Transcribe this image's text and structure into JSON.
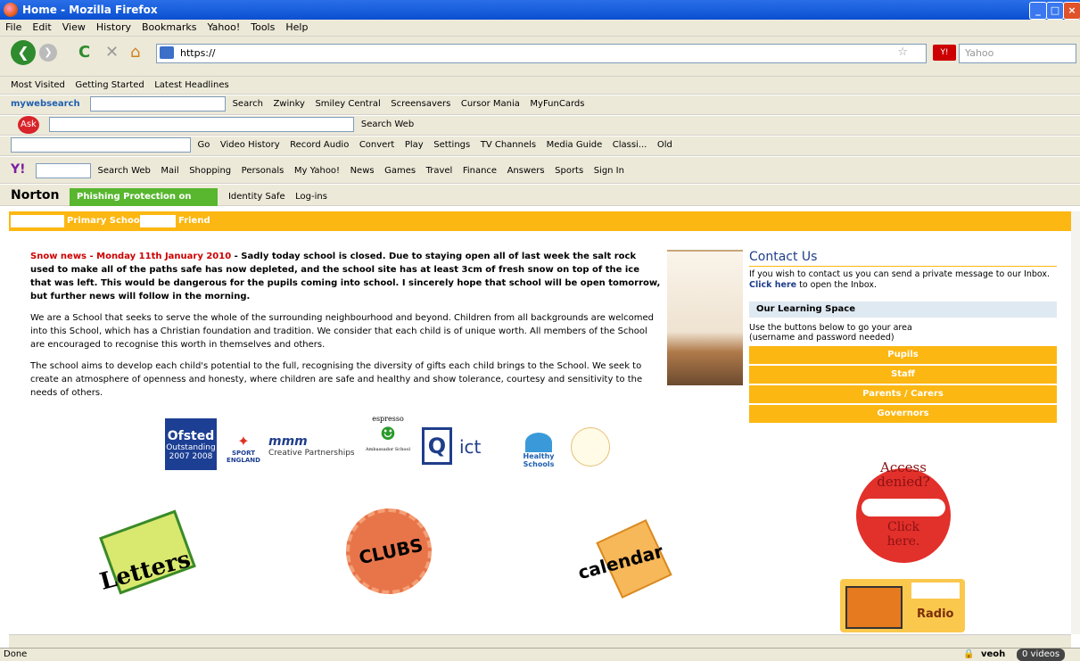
{
  "window": {
    "title": "Home - Mozilla Firefox"
  },
  "menu": [
    "File",
    "Edit",
    "View",
    "History",
    "Bookmarks",
    "Yahoo!",
    "Tools",
    "Help"
  ],
  "nav": {
    "url": "https://",
    "search_placeholder": "Yahoo"
  },
  "bookmarks": [
    "Most Visited",
    "Getting Started",
    "Latest Headlines"
  ],
  "mywebsearch": {
    "brand": "mywebsearch",
    "search": "Search",
    "items": [
      "Zwinky",
      "Smiley Central",
      "Screensavers",
      "Cursor Mania",
      "MyFunCards"
    ]
  },
  "ask": {
    "brand": "Ask",
    "search": "Search Web"
  },
  "toolbar3": {
    "items": [
      "Go",
      "Video History",
      "Record Audio",
      "Convert",
      "Play",
      "Settings",
      "TV Channels",
      "Media Guide",
      "Classi...",
      "Old"
    ]
  },
  "yahoo": {
    "items": [
      "Search Web",
      "Mail",
      "Shopping",
      "Personals",
      "My Yahoo!",
      "News",
      "Games",
      "Travel",
      "Finance",
      "Answers",
      "Sports",
      "Sign In"
    ]
  },
  "norton": {
    "brand": "Norton",
    "phishing": "Phishing Protection on",
    "identity": "Identity Safe",
    "logins": "Log-ins"
  },
  "site_nav": {
    "primary": "Primary School",
    "friend": "Friend"
  },
  "content": {
    "snow_red": "Snow news - Monday 11th January 2010",
    "snow_text": " - Sadly today school is closed. Due to staying open all of last week the salt rock used to make all of the paths safe has now depleted, and the school site has at least 3cm of fresh snow on top of the ice that was left. This would be dangerous for the pupils coming into school. I sincerely hope that school will be open tomorrow, but further news will follow in the morning.",
    "para1": "We are a School that seeks to serve the whole of the surrounding neighbourhood and beyond. Children from all backgrounds are welcomed into this School, which has a Christian foundation and tradition. We consider that each child is of unique worth. All members of the School are encouraged to recognise this worth in themselves and others.",
    "para2": "The school aims to develop each child's potential to the full, recognising the diversity of gifts each child brings to the School. We seek to create an atmosphere of openness and honesty, where children are safe and healthy and show tolerance, courtesy and sensitivity to the needs of others."
  },
  "sidebar": {
    "contact_title": "Contact Us",
    "contact_text": "If you wish to contact us you can send a private message to our Inbox.",
    "click_here": "Click here",
    "open_inbox": " to open the Inbox.",
    "learning_title": "Our Learning Space",
    "learning_text1": "Use the buttons below to go your area",
    "learning_text2": "(username and password needed)",
    "buttons": [
      "Pupils",
      "Staff",
      "Parents / Carers",
      "Governors"
    ]
  },
  "logos": {
    "ofsted1": "Ofsted",
    "ofsted2": "Outstanding",
    "ofsted3": "2007 2008",
    "sport": "SPORT",
    "england": "ENGLAND",
    "creative": "Creative Partnerships",
    "espresso": "espresso",
    "ambassador": "Ambassador School",
    "ict": "ict",
    "healthy": "Healthy Schools"
  },
  "features": {
    "letters": "Letters",
    "clubs": "CLUBS",
    "calendar": "calendar",
    "access1": "Access",
    "access2": "denied?",
    "click1": "Click",
    "click2": "here.",
    "radio": "Radio"
  },
  "status": {
    "text": "Done",
    "veoh": "veoh",
    "videos": "0 videos"
  }
}
